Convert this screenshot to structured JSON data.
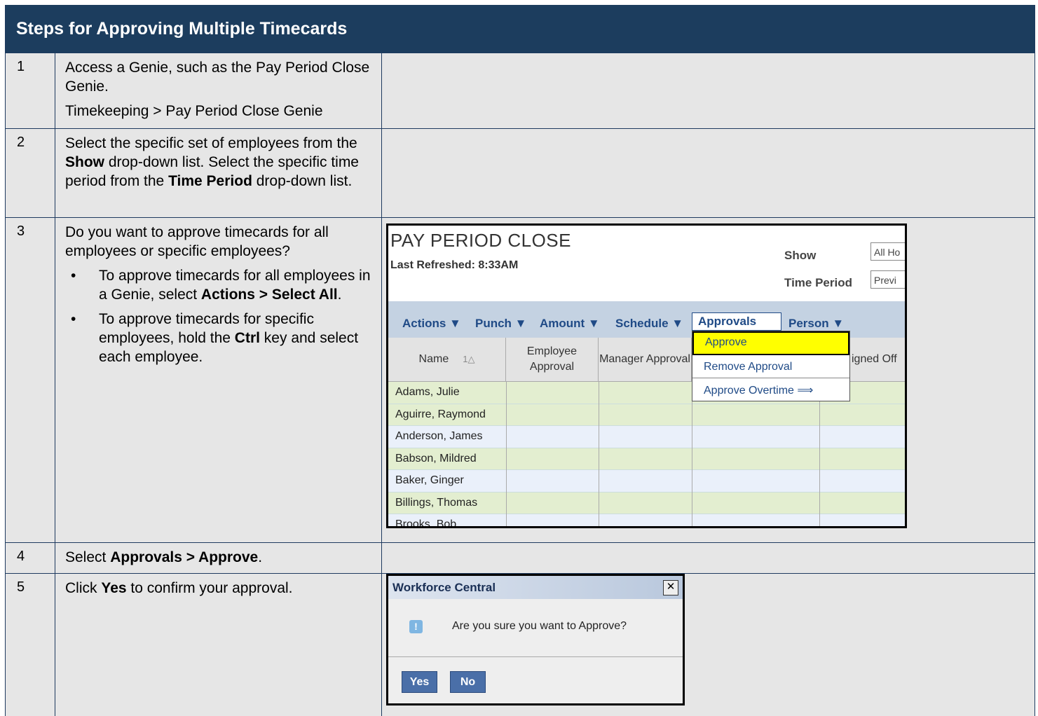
{
  "title": "Steps for Approving Multiple Timecards",
  "steps": [
    {
      "num": "1",
      "lines": [
        "Access a Genie, such as the Pay Period Close Genie.",
        "Timekeeping > Pay Period Close Genie"
      ]
    },
    {
      "num": "2",
      "text": {
        "p1": "Select the specific set of employees from the ",
        "b1": "Show",
        "p2": " drop-down list. Select the specific time period from the ",
        "b2": "Time Period",
        "p3": " drop-down list."
      }
    },
    {
      "num": "3",
      "intro": "Do you want to approve timecards for all employees or specific employees?",
      "bullet1": {
        "p1": "To approve timecards for all employees in a Genie, select ",
        "b1": "Actions > Select All",
        "p2": "."
      },
      "bullet2": {
        "p1": "To approve timecards for specific employees, hold the ",
        "b1": "Ctrl",
        "p2": " key and select each employee."
      }
    },
    {
      "num": "4",
      "text": {
        "p1": "Select ",
        "b1": "Approvals > Approve",
        "p2": "."
      }
    },
    {
      "num": "5",
      "text": {
        "p1": "Click ",
        "b1": "Yes",
        "p2": " to confirm your approval."
      }
    }
  ],
  "ppc": {
    "title": "PAY PERIOD CLOSE",
    "refreshed": "Last Refreshed: 8:33AM",
    "show_label": "Show",
    "show_value": "All Ho",
    "period_label": "Time Period",
    "period_value": "Previ",
    "menus": [
      "Actions ▼",
      "Punch ▼",
      "Amount ▼",
      "Schedule ▼",
      "Approvals",
      "Person ▼"
    ],
    "columns": [
      "Name",
      "1△",
      "Employee Approval",
      "Manager Approval",
      "igned Off"
    ],
    "rows": [
      "Adams, Julie",
      "Aguirre, Raymond",
      "Anderson, James",
      "Babson, Mildred",
      "Baker, Ginger",
      "Billings, Thomas",
      "Brooks, Bob"
    ],
    "dropdown": [
      "Approve",
      "Remove Approval",
      "Approve Overtime"
    ]
  },
  "dialog": {
    "title": "Workforce Central",
    "close": "✕",
    "icon": "!",
    "message": "Are you sure you want to Approve?",
    "yes": "Yes",
    "no": "No"
  }
}
